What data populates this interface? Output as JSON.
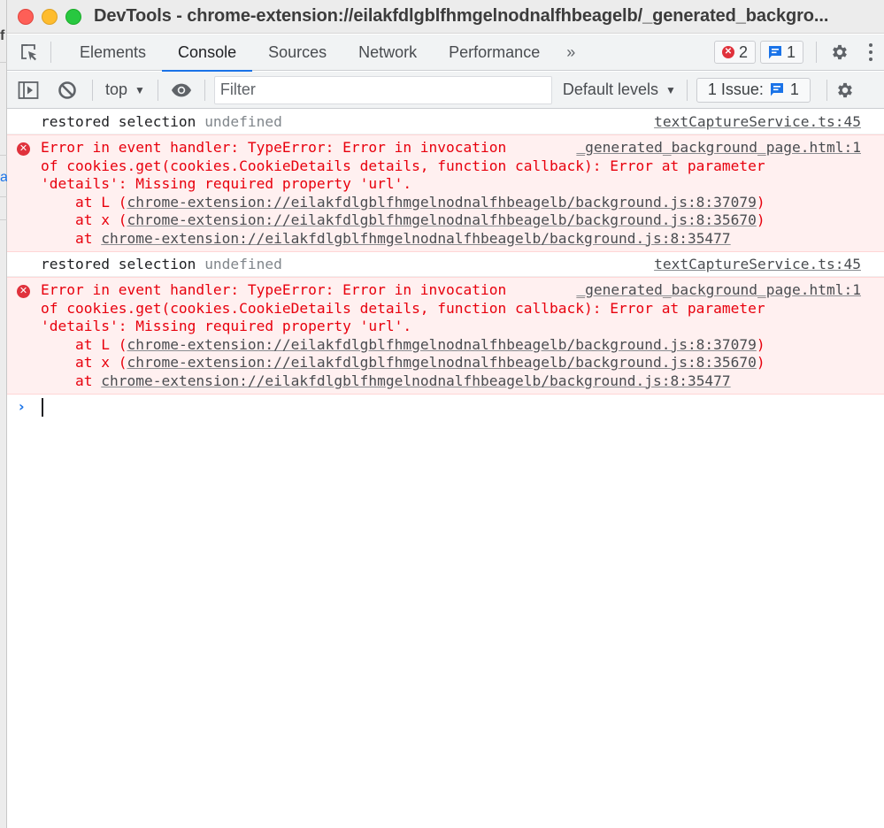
{
  "window": {
    "title": "DevTools - chrome-extension://eilakfdlgblfhmgelnodnalfhbeagelb/_generated_backgro..."
  },
  "background_window": {
    "partial_char_top": "f",
    "partial_char_mid": "a"
  },
  "main_tabs": {
    "inspect_icon": "inspect-element-icon",
    "items": [
      {
        "label": "Elements",
        "active": false
      },
      {
        "label": "Console",
        "active": true
      },
      {
        "label": "Sources",
        "active": false
      },
      {
        "label": "Network",
        "active": false
      },
      {
        "label": "Performance",
        "active": false
      }
    ],
    "more_label": "»",
    "error_count": "2",
    "message_count": "1",
    "settings_icon": "gear-icon",
    "menu_icon": "kebab-menu-icon"
  },
  "console_toolbar": {
    "sidebar_icon": "show-sidebar-icon",
    "clear_icon": "clear-console-icon",
    "context": "top",
    "eye_icon": "live-expression-icon",
    "filter_placeholder": "Filter",
    "filter_value": "",
    "levels": "Default levels",
    "issues_label": "1 Issue:",
    "issues_count": "1",
    "settings_icon": "gear-icon"
  },
  "messages": [
    {
      "type": "log",
      "text": "restored selection",
      "value": "undefined",
      "source": "textCaptureService.ts:45"
    },
    {
      "type": "error",
      "line1": "Error in event handler: TypeError: Error in invocation",
      "line2": "of cookies.get(cookies.CookieDetails details, function callback): Error at parameter",
      "line3": "'details': Missing required property 'url'.",
      "source": "_generated_background_page.html:1",
      "stack": [
        {
          "prefix": "    at L (",
          "link": "chrome-extension://eilakfdlgblfhmgelnodnalfhbeagelb/background.js:8:37079",
          "suffix": ")"
        },
        {
          "prefix": "    at x (",
          "link": "chrome-extension://eilakfdlgblfhmgelnodnalfhbeagelb/background.js:8:35670",
          "suffix": ")"
        },
        {
          "prefix": "    at ",
          "link": "chrome-extension://eilakfdlgblfhmgelnodnalfhbeagelb/background.js:8:35477",
          "suffix": ""
        }
      ]
    },
    {
      "type": "log",
      "text": "restored selection",
      "value": "undefined",
      "source": "textCaptureService.ts:45"
    },
    {
      "type": "error",
      "line1": "Error in event handler: TypeError: Error in invocation",
      "line2": "of cookies.get(cookies.CookieDetails details, function callback): Error at parameter",
      "line3": "'details': Missing required property 'url'.",
      "source": "_generated_background_page.html:1",
      "stack": [
        {
          "prefix": "    at L (",
          "link": "chrome-extension://eilakfdlgblfhmgelnodnalfhbeagelb/background.js:8:37079",
          "suffix": ")"
        },
        {
          "prefix": "    at x (",
          "link": "chrome-extension://eilakfdlgblfhmgelnodnalfhbeagelb/background.js:8:35670",
          "suffix": ")"
        },
        {
          "prefix": "    at ",
          "link": "chrome-extension://eilakfdlgblfhmgelnodnalfhbeagelb/background.js:8:35477",
          "suffix": ""
        }
      ]
    }
  ],
  "prompt": {
    "symbol": "›",
    "value": ""
  },
  "colors": {
    "accent": "#1a73e8",
    "error_text": "#e8000d",
    "error_bg": "#fff0f0",
    "error_icon": "#e0323c"
  }
}
